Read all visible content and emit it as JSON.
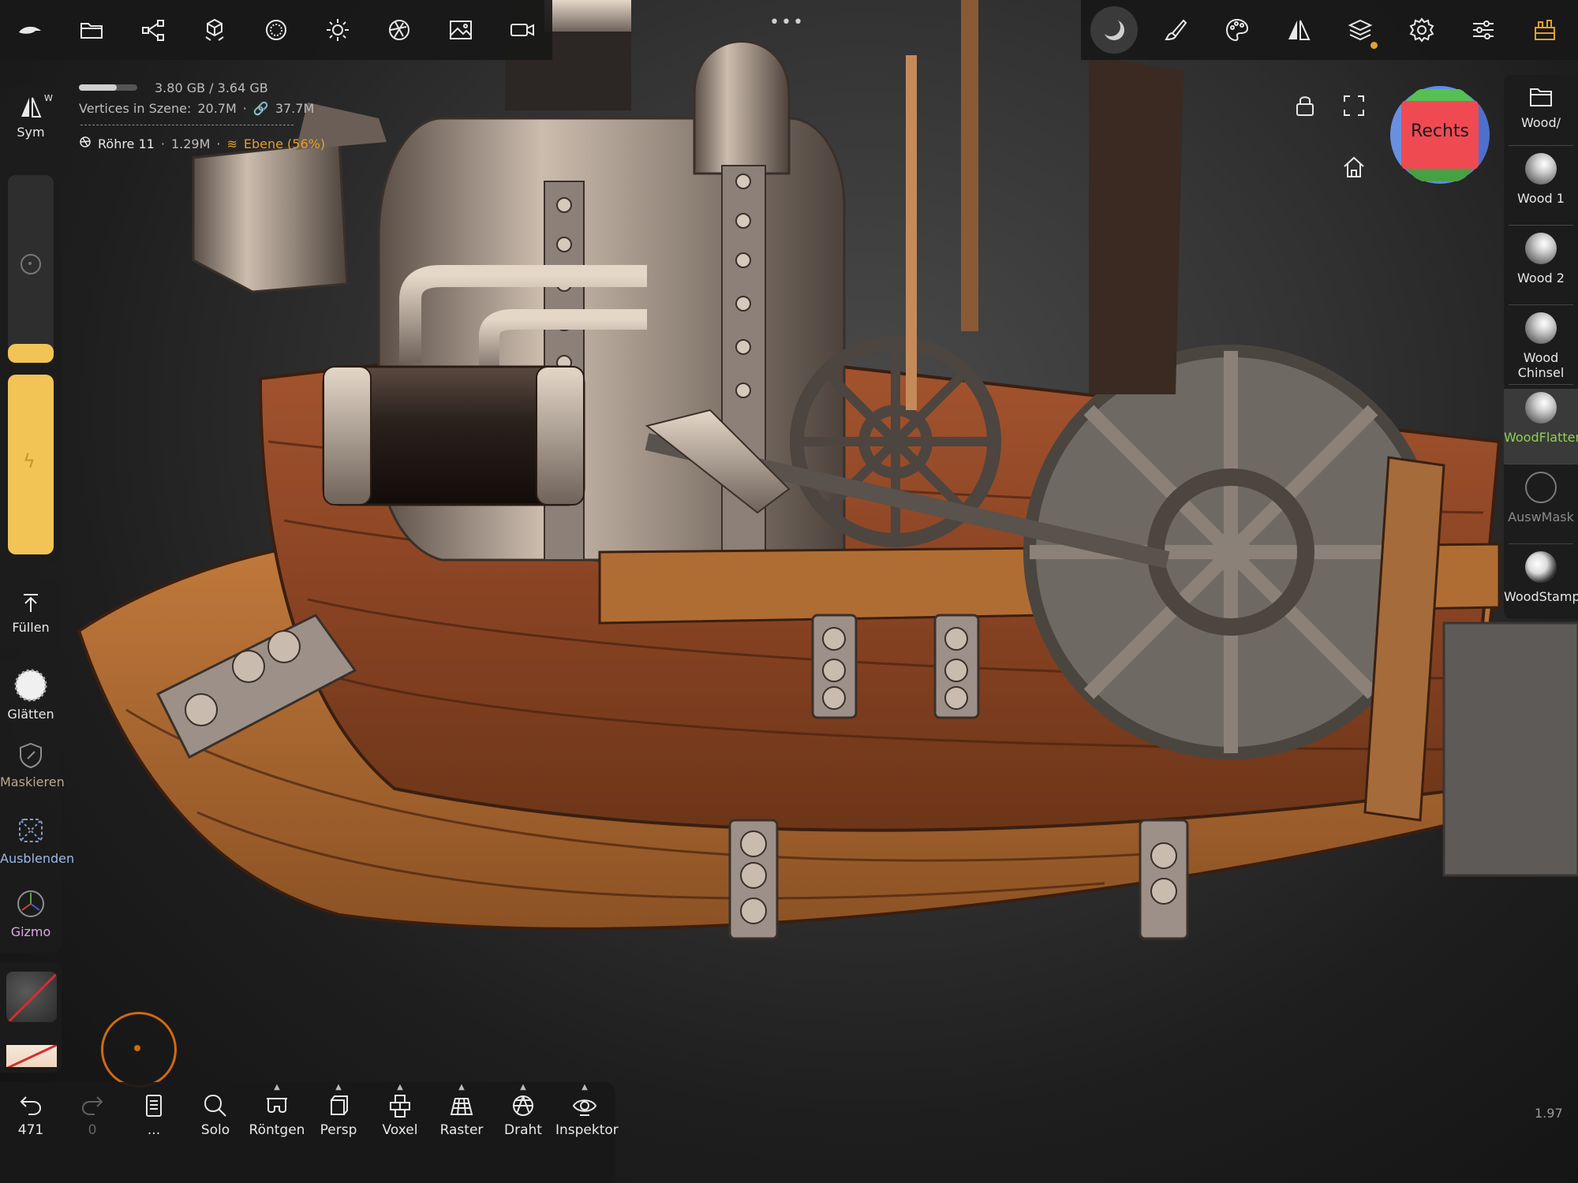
{
  "top_toolbar": {
    "left_icons": [
      "nomad-logo-icon",
      "folder-icon",
      "scene-graph-icon",
      "topology-icon",
      "material-sphere-icon",
      "light-icon",
      "camera-lens-icon",
      "background-image-icon",
      "video-icon"
    ],
    "right_icons": [
      "matcap-icon",
      "paint-brush-icon",
      "palette-icon",
      "symmetry-icon",
      "layers-icon",
      "settings-icon",
      "sliders-icon",
      "plugin-icon"
    ]
  },
  "scene_info": {
    "memory": "3.80 GB / 3.64 GB",
    "memory_fraction": 0.65,
    "vertices_label": "Vertices in Szene:",
    "vertices_count": "20.7M",
    "linked_count": "37.7M",
    "object_name": "Röhre 11",
    "object_vertices": "1.29M",
    "layer_label": "Ebene (56%)"
  },
  "left_panel": {
    "sym_label": "Sym",
    "sym_mode": "W",
    "radius_fraction": 0.1,
    "intensity_fraction": 1.0,
    "fill_label": "Füllen",
    "smooth_label": "Glätten",
    "mask_label": "Maskieren",
    "hide_label": "Ausblenden",
    "gizmo_label": "Gizmo"
  },
  "right_panel": {
    "folder_label": "Wood/",
    "brushes": [
      {
        "label": "Wood 1",
        "selected": false
      },
      {
        "label": "Wood 2",
        "selected": false
      },
      {
        "label": "Wood Chinsel",
        "selected": false
      },
      {
        "label": "WoodFlatten",
        "selected": true
      },
      {
        "label": "AuswMask",
        "selected": false
      },
      {
        "label": "WoodStamp",
        "selected": false
      }
    ],
    "accent_color": "#8fd14f"
  },
  "view_cube": {
    "label": "Rechts"
  },
  "bottom_toolbar": {
    "undo_count": "471",
    "redo_count": "0",
    "history_label": "...",
    "buttons": [
      {
        "name": "solo",
        "label": "Solo"
      },
      {
        "name": "xray",
        "label": "Röntgen"
      },
      {
        "name": "perspective",
        "label": "Persp"
      },
      {
        "name": "voxel",
        "label": "Voxel"
      },
      {
        "name": "grid",
        "label": "Raster"
      },
      {
        "name": "wireframe",
        "label": "Draht"
      },
      {
        "name": "inspector",
        "label": "Inspektor"
      }
    ]
  },
  "fps": "1.97",
  "colors": {
    "brush_yellow": "#f2c455",
    "layer_orange": "#e0a030",
    "accent_green": "#8fd14f"
  }
}
